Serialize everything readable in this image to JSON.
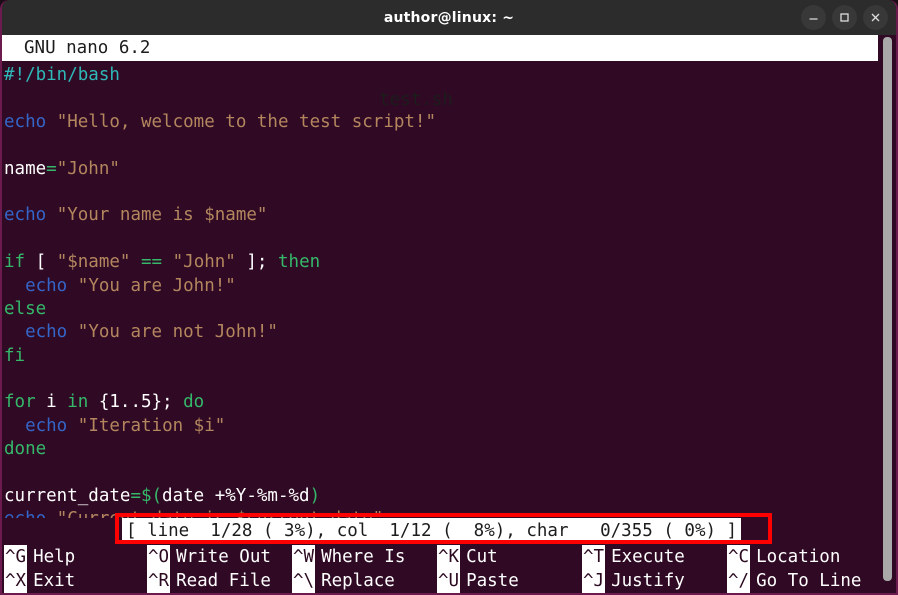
{
  "window": {
    "title": "author@linux: ~",
    "controls": [
      {
        "name": "minimize",
        "glyph": "minimize-icon"
      },
      {
        "name": "maximize",
        "glyph": "maximize-icon"
      },
      {
        "name": "close",
        "glyph": "close-icon"
      }
    ]
  },
  "nano": {
    "version": "GNU nano 6.2",
    "filename": "test.sh"
  },
  "editor": {
    "lines": [
      [
        {
          "t": "#!/bin/bash",
          "c": "shebang"
        }
      ],
      [],
      [
        {
          "t": "echo",
          "c": "cmd"
        },
        {
          "t": " ",
          "c": "plain"
        },
        {
          "t": "\"Hello, welcome to the test script!\"",
          "c": "str"
        }
      ],
      [],
      [
        {
          "t": "name",
          "c": "plain"
        },
        {
          "t": "=",
          "c": "op"
        },
        {
          "t": "\"John\"",
          "c": "str"
        }
      ],
      [],
      [
        {
          "t": "echo",
          "c": "cmd"
        },
        {
          "t": " ",
          "c": "plain"
        },
        {
          "t": "\"Your name is $name\"",
          "c": "str"
        }
      ],
      [],
      [
        {
          "t": "if",
          "c": "kw"
        },
        {
          "t": " [ ",
          "c": "plain"
        },
        {
          "t": "\"$name\"",
          "c": "str"
        },
        {
          "t": " ",
          "c": "plain"
        },
        {
          "t": "==",
          "c": "kw"
        },
        {
          "t": " ",
          "c": "plain"
        },
        {
          "t": "\"John\"",
          "c": "str"
        },
        {
          "t": " ]; ",
          "c": "plain"
        },
        {
          "t": "then",
          "c": "kw"
        }
      ],
      [
        {
          "t": "  ",
          "c": "plain"
        },
        {
          "t": "echo",
          "c": "cmd"
        },
        {
          "t": " ",
          "c": "plain"
        },
        {
          "t": "\"You are John!\"",
          "c": "str"
        }
      ],
      [
        {
          "t": "else",
          "c": "kw"
        }
      ],
      [
        {
          "t": "  ",
          "c": "plain"
        },
        {
          "t": "echo",
          "c": "cmd"
        },
        {
          "t": " ",
          "c": "plain"
        },
        {
          "t": "\"You are not John!\"",
          "c": "str"
        }
      ],
      [
        {
          "t": "fi",
          "c": "kw"
        }
      ],
      [],
      [
        {
          "t": "for",
          "c": "kw"
        },
        {
          "t": " i ",
          "c": "plain"
        },
        {
          "t": "in",
          "c": "kw"
        },
        {
          "t": " {1..5}; ",
          "c": "plain"
        },
        {
          "t": "do",
          "c": "kw"
        }
      ],
      [
        {
          "t": "  ",
          "c": "plain"
        },
        {
          "t": "echo",
          "c": "cmd"
        },
        {
          "t": " ",
          "c": "plain"
        },
        {
          "t": "\"Iteration $i\"",
          "c": "str"
        }
      ],
      [
        {
          "t": "done",
          "c": "kw"
        }
      ],
      [],
      [
        {
          "t": "current_date",
          "c": "plain"
        },
        {
          "t": "=$(",
          "c": "op"
        },
        {
          "t": "date +%Y-%m-%d",
          "c": "plain"
        },
        {
          "t": ")",
          "c": "op"
        }
      ],
      [
        {
          "t": "echo",
          "c": "cmd"
        },
        {
          "t": " ",
          "c": "plain"
        },
        {
          "t": "\"Current date is $current_date\"",
          "c": "str"
        }
      ]
    ]
  },
  "status": {
    "text": "[ line  1/28 ( 3%), col  1/12 (  8%), char   0/355 ( 0%) ]",
    "annotation_color": "#ff0000"
  },
  "shortcuts": {
    "row_top": [
      {
        "key": "^G",
        "label": "Help"
      },
      {
        "key": "^O",
        "label": "Write Out"
      },
      {
        "key": "^W",
        "label": "Where Is"
      },
      {
        "key": "^K",
        "label": "Cut"
      },
      {
        "key": "^T",
        "label": "Execute"
      },
      {
        "key": "^C",
        "label": "Location"
      }
    ],
    "row_bottom": [
      {
        "key": "^X",
        "label": "Exit"
      },
      {
        "key": "^R",
        "label": "Read File"
      },
      {
        "key": "^\\",
        "label": "Replace"
      },
      {
        "key": "^U",
        "label": "Paste"
      },
      {
        "key": "^J",
        "label": "Justify"
      },
      {
        "key": "^/",
        "label": "Go To Line"
      }
    ]
  },
  "colors": {
    "terminal_bg": "#300a24",
    "titlebar_bg": "#2c2c2c",
    "window_border": "#6b1b4d",
    "inverse_bg": "#ffffff",
    "annotation": "#ff0000",
    "scrollbar": "#a9a9a9"
  }
}
